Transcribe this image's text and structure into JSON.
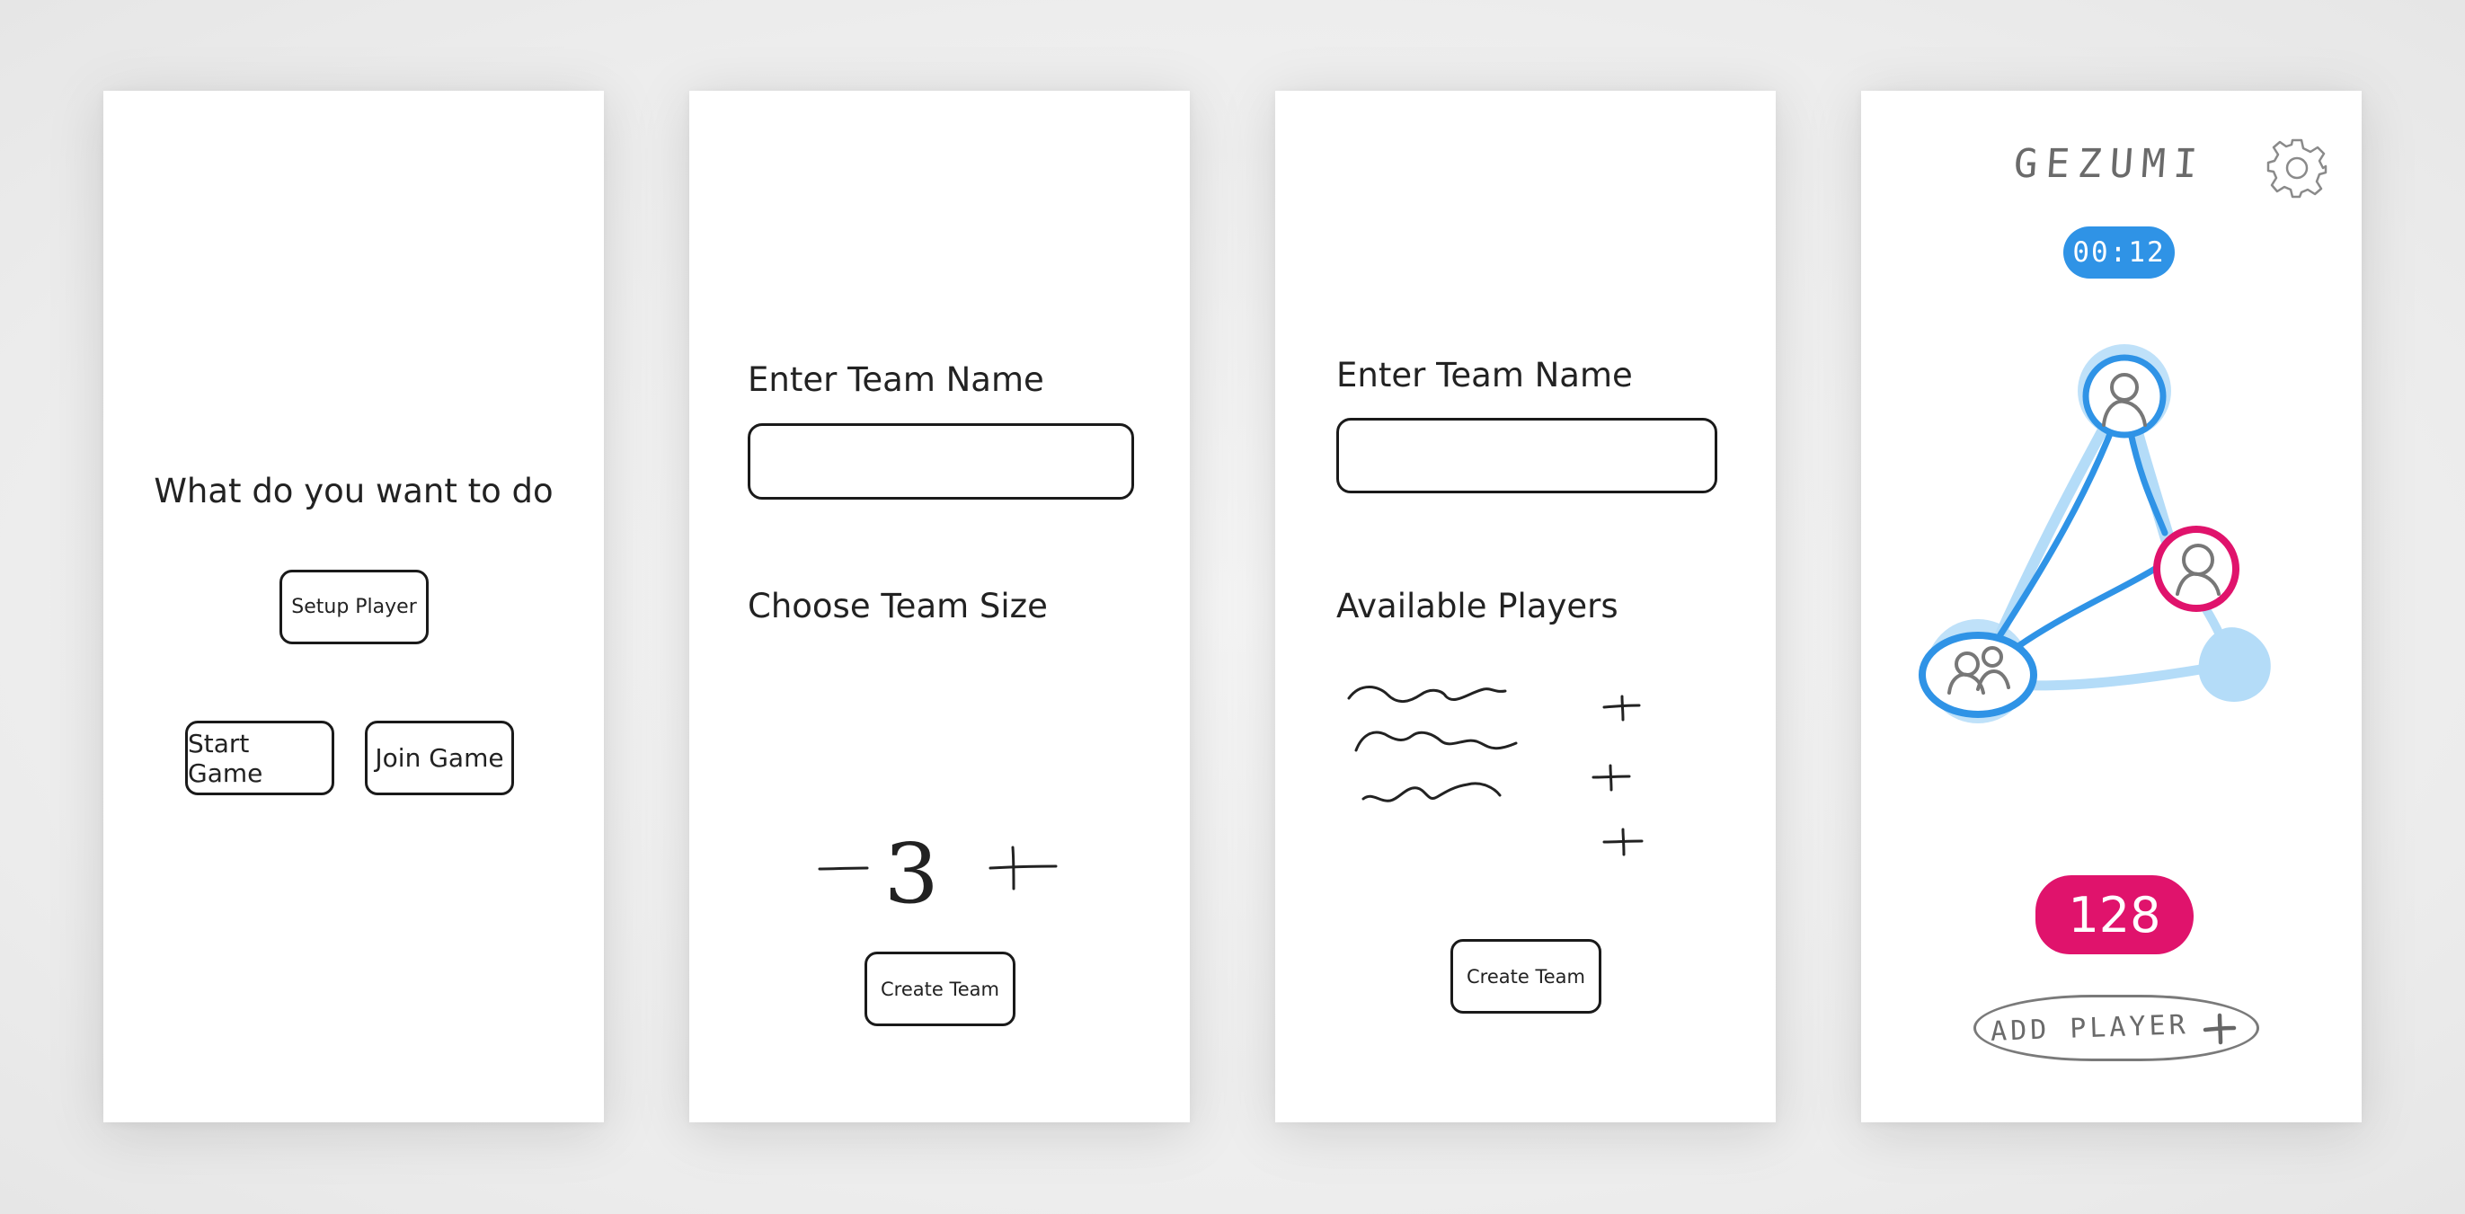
{
  "screen1": {
    "prompt": "What do you want to do",
    "setup_player_label": "Setup Player",
    "start_game_label": "Start Game",
    "join_game_label": "Join Game"
  },
  "screen2": {
    "team_name_label": "Enter Team Name",
    "team_name_value": "",
    "team_size_label": "Choose Team Size",
    "team_size_value": 3,
    "create_team_label": "Create Team"
  },
  "screen3": {
    "team_name_label": "Enter Team Name",
    "team_name_value": "",
    "available_players_label": "Available Players",
    "create_team_label": "Create Team"
  },
  "screen4": {
    "logo_text": "GEZUMI",
    "timer": "00:12",
    "score": "128",
    "add_player_label": "ADD PLAYER",
    "icons": [
      "gear-icon",
      "player-avatar-icon",
      "plus-icon"
    ]
  },
  "colors": {
    "accent_blue": "#2f93e6",
    "light_blue": "#b4dcf8",
    "accent_magenta": "#e0136c",
    "sketch_grey": "#6a6a6a"
  }
}
